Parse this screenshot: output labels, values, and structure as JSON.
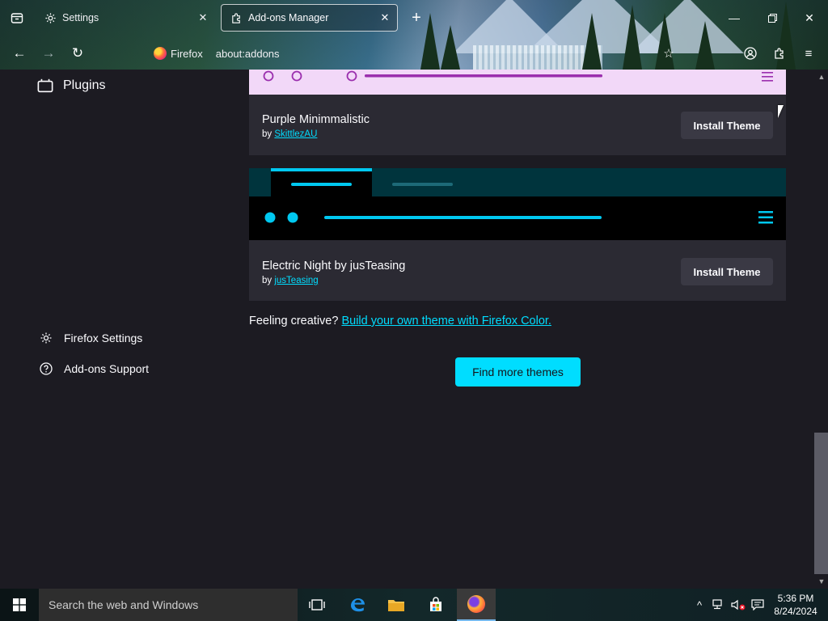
{
  "browser": {
    "tabs": [
      {
        "label": "Settings",
        "icon": "gear-icon",
        "active": false
      },
      {
        "label": "Add-ons Manager",
        "icon": "puzzle-icon",
        "active": true
      }
    ],
    "identity_label": "Firefox",
    "url": "about:addons"
  },
  "sidebar": {
    "category": "Plugins",
    "footer": [
      {
        "label": "Firefox Settings",
        "icon": "gear-icon"
      },
      {
        "label": "Add-ons Support",
        "icon": "help-icon"
      }
    ]
  },
  "themes": [
    {
      "name": "Purple Minimmalistic",
      "by_prefix": "by",
      "author": "SkittlezAU",
      "button": "Install Theme",
      "accent": "#9b2fae",
      "bg": "#f2d8f8"
    },
    {
      "name": "Electric Night by jusTeasing",
      "by_prefix": "by",
      "author": "jusTeasing",
      "button": "Install Theme",
      "accent": "#00c8f0",
      "bg": "#000000"
    }
  ],
  "creative": {
    "text": "Feeling creative?",
    "link": "Build your own theme with Firefox Color."
  },
  "find_more_label": "Find more themes",
  "taskbar": {
    "search_placeholder": "Search the web and Windows",
    "time": "5:36 PM",
    "date": "8/24/2024"
  },
  "colors": {
    "page_bg": "#1c1b22",
    "card_bg": "#2b2a33",
    "link": "#00ddff",
    "primary_button": "#00ddff"
  }
}
